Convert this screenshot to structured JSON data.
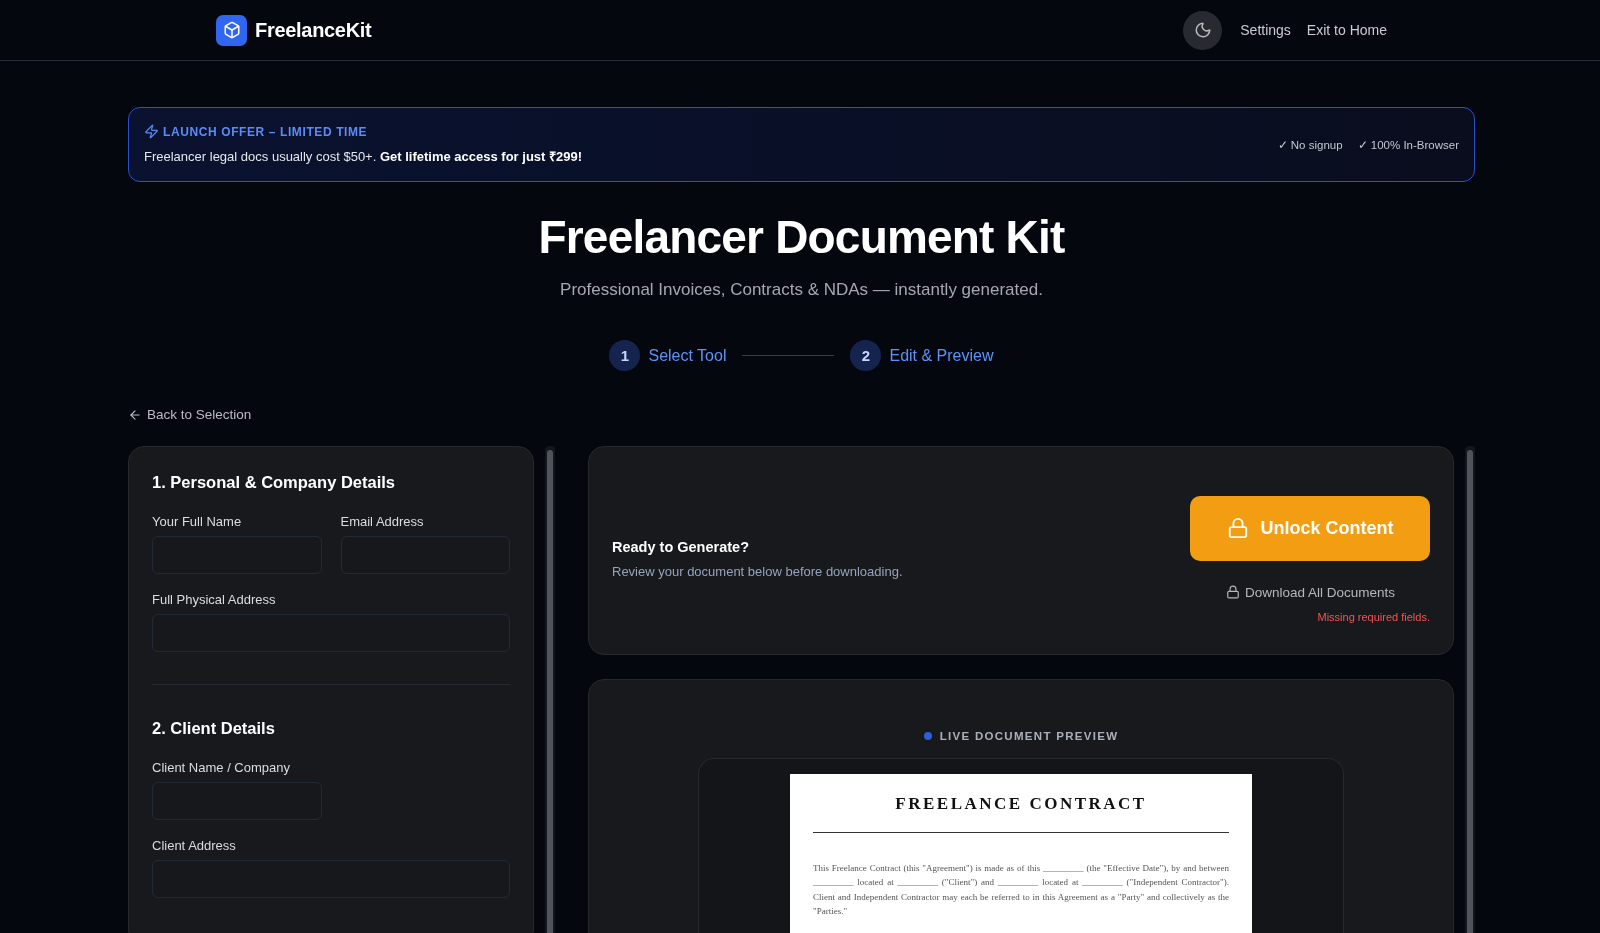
{
  "nav": {
    "brand": "FreelanceKit",
    "links": [
      "Settings",
      "Exit to Home"
    ]
  },
  "banner": {
    "tag": "LAUNCH OFFER – LIMITED TIME",
    "message": "Freelancer legal docs usually cost $50+. **Get lifetime access for just ₹299!**",
    "features": [
      "✓ No signup",
      "✓ 100% In-Browser"
    ]
  },
  "hero": {
    "title": "Freelancer Document Kit",
    "subtitle": "Professional Invoices, Contracts & NDAs — instantly generated."
  },
  "steps": [
    {
      "number": "1",
      "label": "Select Tool"
    },
    {
      "number": "2",
      "label": "Edit & Preview"
    }
  ],
  "back_link": "Back to Selection",
  "form_sections": [
    {
      "title": "1. Personal & Company Details",
      "fields": [
        {
          "label": "Your Full Name",
          "kind": "narrow"
        },
        {
          "label": "Email Address",
          "kind": "narrow"
        },
        {
          "label": "Full Physical Address",
          "kind": "wide"
        }
      ]
    },
    {
      "title": "2. Client Details",
      "fields": [
        {
          "label": "Client Name / Company",
          "kind": "narrow"
        },
        {
          "label": "Client Address",
          "kind": "wide"
        }
      ]
    }
  ],
  "generate": {
    "title": "Ready to Generate?",
    "subtitle": "Review your document below before downloading.",
    "unlock_button": "Unlock Content",
    "download_button": "Download All Documents",
    "error": "Missing required fields."
  },
  "preview": {
    "label": "LIVE DOCUMENT PREVIEW",
    "doc_title": "FREELANCE CONTRACT",
    "doc_body": "This Freelance Contract (this \"Agreement\") is made as of this _________ (the \"Effective Date\"), by and between _________ located at _________ (\"Client\") and _________ located at _________ (\"Independent Contractor\"). Client and Independent Contractor may each be referred to in this Agreement as a \"Party\" and collectively as the \"Parties.\""
  }
}
